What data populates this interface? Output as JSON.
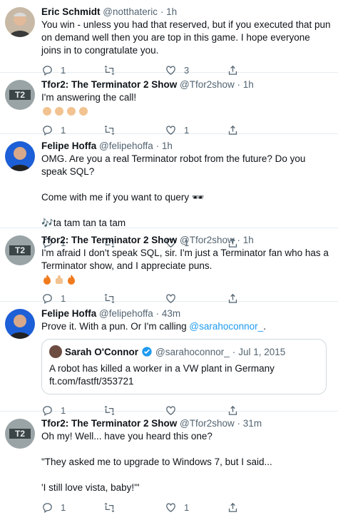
{
  "tweets": [
    {
      "name": "Eric Schmidt",
      "handle": "@notthateric",
      "sep": "·",
      "time": "1h",
      "lines": [
        "You win - unless you had that reserved, but if you executed that pun on demand well then you are top in this game. I hope everyone joins in to congratulate you."
      ],
      "reply_count": "1",
      "retweet_count": "",
      "like_count": "3"
    },
    {
      "name": "Tfor2: The Terminator 2 Show",
      "handle": "@Tfor2show",
      "sep": "·",
      "time": "1h",
      "lines": [
        "I'm answering the call!"
      ],
      "reply_count": "1",
      "retweet_count": "",
      "like_count": "1"
    },
    {
      "name": "Felipe Hoffa",
      "handle": "@felipehoffa",
      "sep": "·",
      "time": "1h",
      "lines": [
        "OMG. Are you a real Terminator robot from the future? Do you speak SQL?",
        "Come with me if you want to query 🕶",
        "🎶ta tam tan ta tam"
      ],
      "reply_count": "1",
      "retweet_count": "",
      "like_count": "1"
    },
    {
      "name": "Tfor2: The Terminator 2 Show",
      "handle": "@Tfor2show",
      "sep": "·",
      "time": "1h",
      "lines": [
        "I'm afraid I don't speak SQL, sir.  I'm just a Terminator fan who has a Terminator show, and I appreciate puns."
      ],
      "reply_count": "1",
      "retweet_count": "",
      "like_count": ""
    },
    {
      "name": "Felipe Hoffa",
      "handle": "@felipehoffa",
      "sep": "·",
      "time": "43m",
      "lines": [
        "Prove it. With a pun. Or I'm calling "
      ],
      "mention": "@sarahoconnor_",
      "mention_suffix": ".",
      "quote": {
        "name": "Sarah O'Connor",
        "handle": "@sarahoconnor_",
        "sep": "·",
        "date": "Jul 1, 2015",
        "text": "A robot has killed a worker in a VW plant in Germany ft.com/fastft/353721"
      },
      "reply_count": "1",
      "retweet_count": "",
      "like_count": ""
    },
    {
      "name": "Tfor2: The Terminator 2 Show",
      "handle": "@Tfor2show",
      "sep": "·",
      "time": "31m",
      "lines": [
        "Oh my!  Well... have you heard this one?",
        "\"They asked me to upgrade to Windows 7, but I said...",
        "'I still love vista, baby!'\""
      ],
      "reply_count": "1",
      "retweet_count": "",
      "like_count": "1"
    }
  ],
  "colors": {
    "accent": "#1d9bf0",
    "muted": "#536471",
    "border": "#e6ecf0"
  },
  "icons": [
    "reply-icon",
    "retweet-icon",
    "like-icon",
    "share-icon",
    "verified-badge-icon",
    "clap-emoji",
    "fire-emoji",
    "thumbs-up-emoji"
  ]
}
